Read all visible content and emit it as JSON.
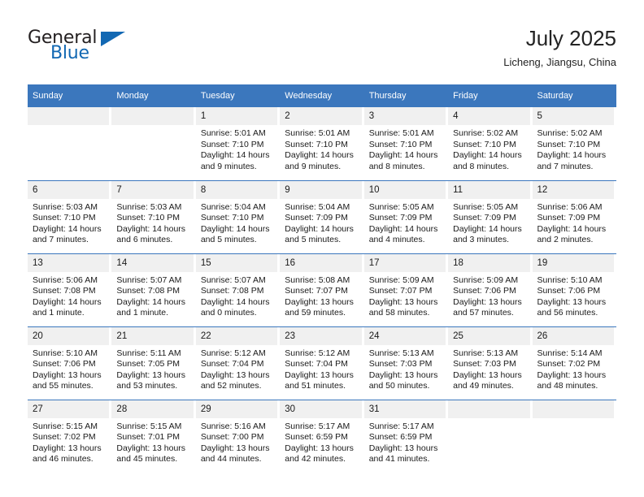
{
  "brand": {
    "name_part1": "General",
    "name_part2": "Blue",
    "triangle_icon": "logo-triangle-icon",
    "accent_color": "#1268b3"
  },
  "header": {
    "month_title": "July 2025",
    "location": "Licheng, Jiangsu, China"
  },
  "colors": {
    "header_blue": "#3b77bd",
    "daynum_band": "#f0f0f0",
    "text": "#1a1a1a"
  },
  "calendar": {
    "weekday_headers": [
      "Sunday",
      "Monday",
      "Tuesday",
      "Wednesday",
      "Thursday",
      "Friday",
      "Saturday"
    ],
    "weeks": [
      [
        {
          "day": "",
          "lines": []
        },
        {
          "day": "",
          "lines": []
        },
        {
          "day": "1",
          "lines": [
            "Sunrise: 5:01 AM",
            "Sunset: 7:10 PM",
            "Daylight: 14 hours",
            "and 9 minutes."
          ]
        },
        {
          "day": "2",
          "lines": [
            "Sunrise: 5:01 AM",
            "Sunset: 7:10 PM",
            "Daylight: 14 hours",
            "and 9 minutes."
          ]
        },
        {
          "day": "3",
          "lines": [
            "Sunrise: 5:01 AM",
            "Sunset: 7:10 PM",
            "Daylight: 14 hours",
            "and 8 minutes."
          ]
        },
        {
          "day": "4",
          "lines": [
            "Sunrise: 5:02 AM",
            "Sunset: 7:10 PM",
            "Daylight: 14 hours",
            "and 8 minutes."
          ]
        },
        {
          "day": "5",
          "lines": [
            "Sunrise: 5:02 AM",
            "Sunset: 7:10 PM",
            "Daylight: 14 hours",
            "and 7 minutes."
          ]
        }
      ],
      [
        {
          "day": "6",
          "lines": [
            "Sunrise: 5:03 AM",
            "Sunset: 7:10 PM",
            "Daylight: 14 hours",
            "and 7 minutes."
          ]
        },
        {
          "day": "7",
          "lines": [
            "Sunrise: 5:03 AM",
            "Sunset: 7:10 PM",
            "Daylight: 14 hours",
            "and 6 minutes."
          ]
        },
        {
          "day": "8",
          "lines": [
            "Sunrise: 5:04 AM",
            "Sunset: 7:10 PM",
            "Daylight: 14 hours",
            "and 5 minutes."
          ]
        },
        {
          "day": "9",
          "lines": [
            "Sunrise: 5:04 AM",
            "Sunset: 7:09 PM",
            "Daylight: 14 hours",
            "and 5 minutes."
          ]
        },
        {
          "day": "10",
          "lines": [
            "Sunrise: 5:05 AM",
            "Sunset: 7:09 PM",
            "Daylight: 14 hours",
            "and 4 minutes."
          ]
        },
        {
          "day": "11",
          "lines": [
            "Sunrise: 5:05 AM",
            "Sunset: 7:09 PM",
            "Daylight: 14 hours",
            "and 3 minutes."
          ]
        },
        {
          "day": "12",
          "lines": [
            "Sunrise: 5:06 AM",
            "Sunset: 7:09 PM",
            "Daylight: 14 hours",
            "and 2 minutes."
          ]
        }
      ],
      [
        {
          "day": "13",
          "lines": [
            "Sunrise: 5:06 AM",
            "Sunset: 7:08 PM",
            "Daylight: 14 hours",
            "and 1 minute."
          ]
        },
        {
          "day": "14",
          "lines": [
            "Sunrise: 5:07 AM",
            "Sunset: 7:08 PM",
            "Daylight: 14 hours",
            "and 1 minute."
          ]
        },
        {
          "day": "15",
          "lines": [
            "Sunrise: 5:07 AM",
            "Sunset: 7:08 PM",
            "Daylight: 14 hours",
            "and 0 minutes."
          ]
        },
        {
          "day": "16",
          "lines": [
            "Sunrise: 5:08 AM",
            "Sunset: 7:07 PM",
            "Daylight: 13 hours",
            "and 59 minutes."
          ]
        },
        {
          "day": "17",
          "lines": [
            "Sunrise: 5:09 AM",
            "Sunset: 7:07 PM",
            "Daylight: 13 hours",
            "and 58 minutes."
          ]
        },
        {
          "day": "18",
          "lines": [
            "Sunrise: 5:09 AM",
            "Sunset: 7:06 PM",
            "Daylight: 13 hours",
            "and 57 minutes."
          ]
        },
        {
          "day": "19",
          "lines": [
            "Sunrise: 5:10 AM",
            "Sunset: 7:06 PM",
            "Daylight: 13 hours",
            "and 56 minutes."
          ]
        }
      ],
      [
        {
          "day": "20",
          "lines": [
            "Sunrise: 5:10 AM",
            "Sunset: 7:06 PM",
            "Daylight: 13 hours",
            "and 55 minutes."
          ]
        },
        {
          "day": "21",
          "lines": [
            "Sunrise: 5:11 AM",
            "Sunset: 7:05 PM",
            "Daylight: 13 hours",
            "and 53 minutes."
          ]
        },
        {
          "day": "22",
          "lines": [
            "Sunrise: 5:12 AM",
            "Sunset: 7:04 PM",
            "Daylight: 13 hours",
            "and 52 minutes."
          ]
        },
        {
          "day": "23",
          "lines": [
            "Sunrise: 5:12 AM",
            "Sunset: 7:04 PM",
            "Daylight: 13 hours",
            "and 51 minutes."
          ]
        },
        {
          "day": "24",
          "lines": [
            "Sunrise: 5:13 AM",
            "Sunset: 7:03 PM",
            "Daylight: 13 hours",
            "and 50 minutes."
          ]
        },
        {
          "day": "25",
          "lines": [
            "Sunrise: 5:13 AM",
            "Sunset: 7:03 PM",
            "Daylight: 13 hours",
            "and 49 minutes."
          ]
        },
        {
          "day": "26",
          "lines": [
            "Sunrise: 5:14 AM",
            "Sunset: 7:02 PM",
            "Daylight: 13 hours",
            "and 48 minutes."
          ]
        }
      ],
      [
        {
          "day": "27",
          "lines": [
            "Sunrise: 5:15 AM",
            "Sunset: 7:02 PM",
            "Daylight: 13 hours",
            "and 46 minutes."
          ]
        },
        {
          "day": "28",
          "lines": [
            "Sunrise: 5:15 AM",
            "Sunset: 7:01 PM",
            "Daylight: 13 hours",
            "and 45 minutes."
          ]
        },
        {
          "day": "29",
          "lines": [
            "Sunrise: 5:16 AM",
            "Sunset: 7:00 PM",
            "Daylight: 13 hours",
            "and 44 minutes."
          ]
        },
        {
          "day": "30",
          "lines": [
            "Sunrise: 5:17 AM",
            "Sunset: 6:59 PM",
            "Daylight: 13 hours",
            "and 42 minutes."
          ]
        },
        {
          "day": "31",
          "lines": [
            "Sunrise: 5:17 AM",
            "Sunset: 6:59 PM",
            "Daylight: 13 hours",
            "and 41 minutes."
          ]
        },
        {
          "day": "",
          "lines": []
        },
        {
          "day": "",
          "lines": []
        }
      ]
    ]
  }
}
